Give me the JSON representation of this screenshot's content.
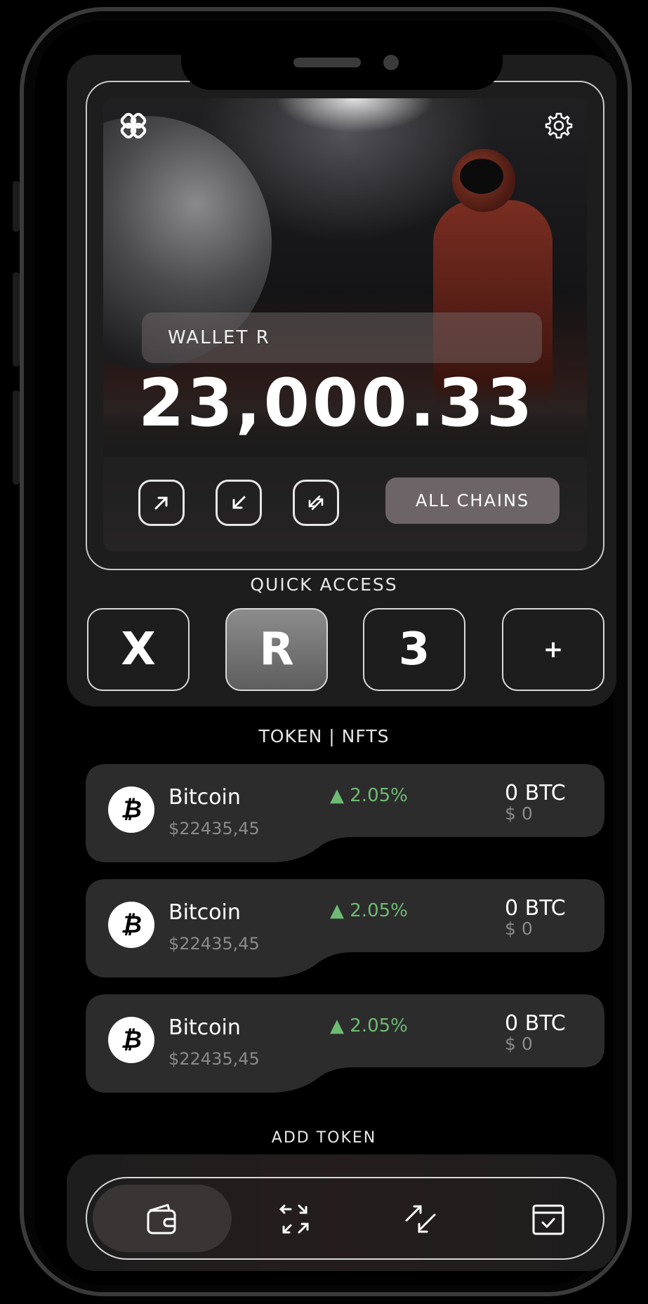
{
  "wallet": {
    "label": "WALLET R",
    "balance": "23,000.33",
    "all_chains_label": "ALL CHAINS"
  },
  "quick_access": {
    "title": "QUICK ACCESS",
    "items": [
      "X",
      "R",
      "3",
      "+"
    ],
    "active_index": 1
  },
  "tabs_title": "TOKEN | NFTS",
  "tokens": [
    {
      "symbol_glyph": "₿",
      "name": "Bitcoin",
      "price": "$22435,45",
      "change": "▲ 2.05%",
      "amount": "0 BTC",
      "usd": "$ 0"
    },
    {
      "symbol_glyph": "₿",
      "name": "Bitcoin",
      "price": "$22435,45",
      "change": "▲ 2.05%",
      "amount": "0 BTC",
      "usd": "$ 0"
    },
    {
      "symbol_glyph": "₿",
      "name": "Bitcoin",
      "price": "$22435,45",
      "change": "▲ 2.05%",
      "amount": "0 BTC",
      "usd": "$ 0"
    }
  ],
  "add_token_label": "ADD TOKEN",
  "bottom_nav": {
    "icons": [
      "wallet-icon",
      "swap-arrows-icon",
      "transfer-icon",
      "calendar-icon"
    ],
    "active_index": 0
  },
  "colors": {
    "positive": "#6dbb73",
    "background": "#000000",
    "panel": "#1d1d1d",
    "chains_button": "#6c6466"
  }
}
